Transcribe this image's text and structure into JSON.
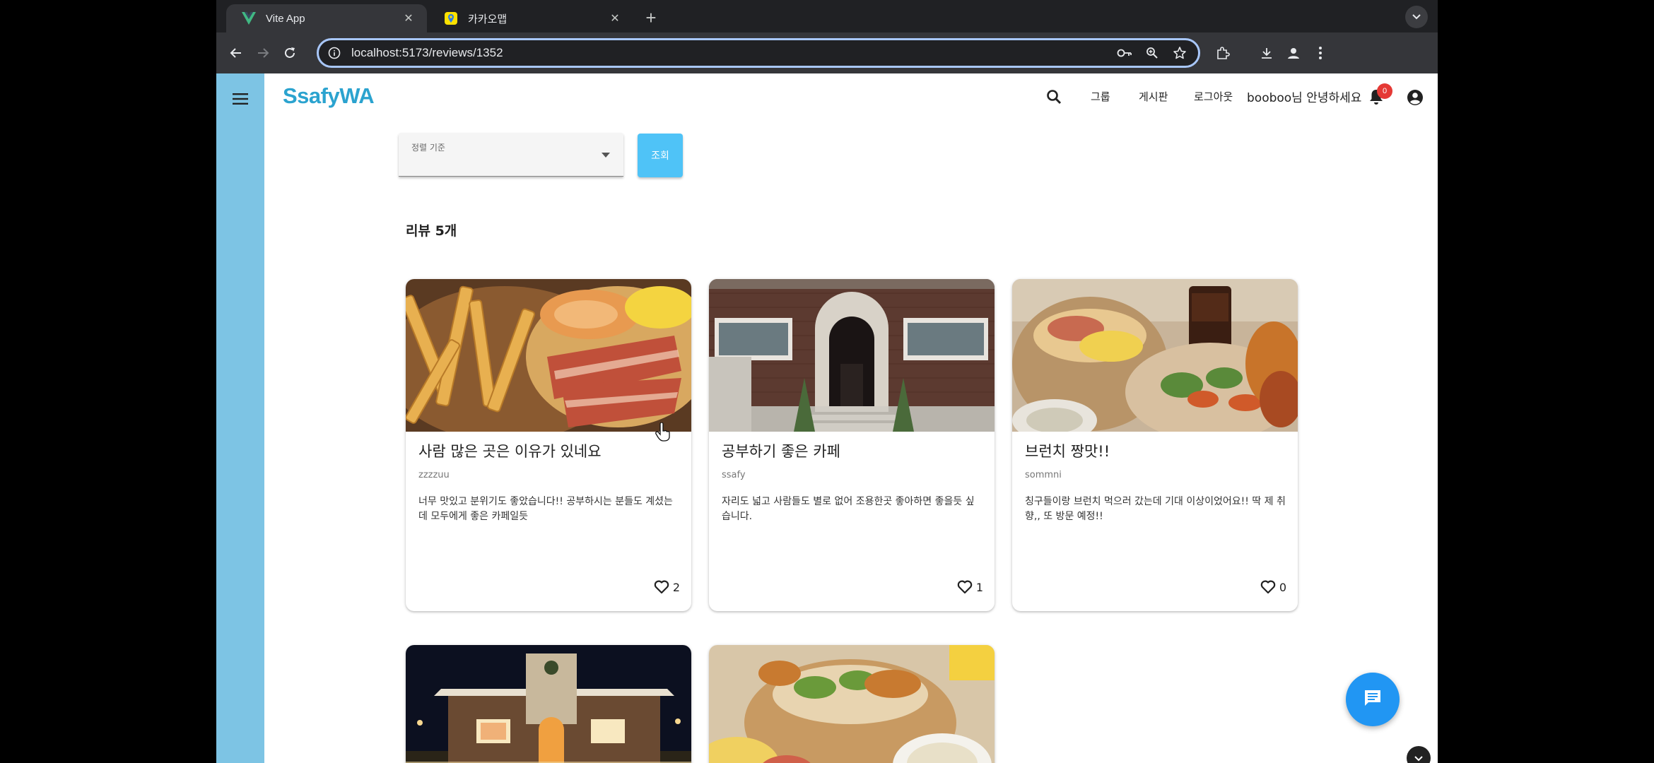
{
  "browser": {
    "tabs": [
      {
        "title": "Vite App",
        "favicon": "vue-logo-icon",
        "active": true
      },
      {
        "title": "카카오맵",
        "favicon": "kakaomap-icon",
        "active": false
      }
    ],
    "url": "localhost:5173/reviews/1352"
  },
  "header": {
    "logo": "SsafyWA",
    "nav": {
      "group": "그룹",
      "board": "게시판",
      "logout": "로그아웃",
      "greeting": "booboo님 안녕하세요"
    },
    "notification_count": "0"
  },
  "filter": {
    "sort_label": "정렬 기준",
    "search_button": "조회"
  },
  "review_count": "리뷰 5개",
  "reviews": [
    {
      "title": "사람 많은 곳은 이유가 있네요",
      "author": "zzzzuu",
      "body": "너무 맛있고 분위기도 좋았습니다!! 공부하시는 분들도 계셨는데 모두에게 좋은 카페일듯",
      "likes": "2"
    },
    {
      "title": "공부하기 좋은 카페",
      "author": "ssafy",
      "body": "자리도 넓고 사람들도 별로 없어 조용한곳 좋아하면 좋을듯 싶습니다.",
      "likes": "1"
    },
    {
      "title": "브런치 짱맛!!",
      "author": "sommni",
      "body": "칭구들이랑 브런치 먹으러 갔는데 기대 이상이었어요!! 딱 제 취향,, 또 방문 예정!!",
      "likes": "0"
    }
  ],
  "colors": {
    "sidebar": "#7dc4e4",
    "logo": "#2ba3cf",
    "button": "#4fc3f7",
    "fab": "#2196f3",
    "badge": "#e53935"
  }
}
